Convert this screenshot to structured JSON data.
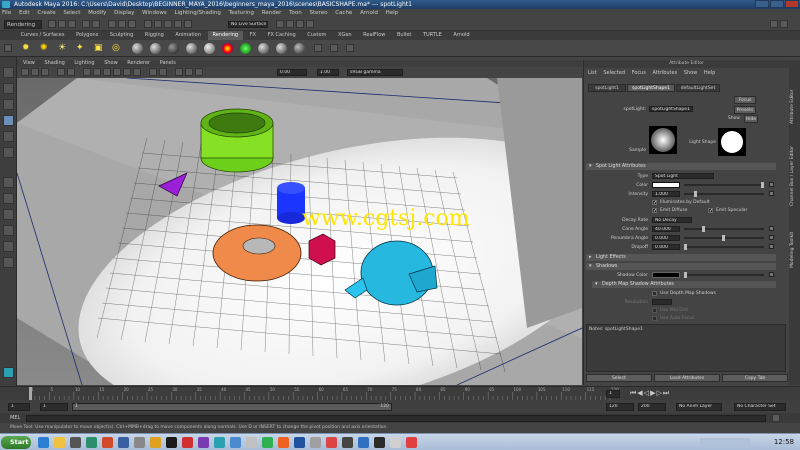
{
  "window": {
    "title": "Autodesk Maya 2016: C:\\Users\\David\\Desktop\\BEGINNER_MAYA_2016\\beginners_maya_2016\\scenes\\BASICSHAPE.ma*   ---   spotLight1"
  },
  "menubar": [
    "File",
    "Edit",
    "Create",
    "Select",
    "Modify",
    "Display",
    "Windows",
    "Lighting/Shading",
    "Texturing",
    "Render",
    "Toon",
    "Stereo",
    "Cache",
    "Arnold",
    "Help"
  ],
  "status": {
    "mode": "Rendering",
    "surface_field": "No Live Surface"
  },
  "shelf_tabs": [
    "Curves / Surfaces",
    "Polygons",
    "Sculpting",
    "Rigging",
    "Animation",
    "Rendering",
    "FX",
    "FX Caching",
    "Custom",
    "XGen",
    "RealFlow",
    "Bullet",
    "TURTLE",
    "Arnold"
  ],
  "shelf_active_tab": "Rendering",
  "viewport": {
    "menu": [
      "View",
      "Shading",
      "Lighting",
      "Show",
      "Renderer",
      "Panels"
    ],
    "field_a": "0.00",
    "field_b": "1.00",
    "color_space": "sRGB gamma",
    "watermark": "www.cgtsj.com"
  },
  "attribute_editor": {
    "title": "Attribute Editor",
    "menu": [
      "List",
      "Selected",
      "Focus",
      "Attributes",
      "Show",
      "Help"
    ],
    "node_tabs": [
      "spotLight1",
      "spotLightShape1",
      "defaultLightSet"
    ],
    "active_tab": "spotLightShape1",
    "node_label": "spotLight:",
    "node_value": "spotLightShape1",
    "focus_btn": "Focus",
    "presets_btn": "Presets",
    "show_label": "Show",
    "hide_btn": "Hide",
    "sample_label": "Sample",
    "light_shape_label": "Light Shape",
    "sections": {
      "spot_light_attributes": "Spot Light Attributes",
      "light_effects": "Light Effects",
      "shadows": "Shadows",
      "depth_map": "Depth Map Shadow Attributes"
    },
    "attrs": {
      "type_label": "Type",
      "type_value": "Spot Light",
      "color_label": "Color",
      "intensity_label": "Intensity",
      "intensity_value": "1.000",
      "illuminates_label": "Illuminates by Default",
      "emit_diffuse_label": "Emit Diffuse",
      "emit_specular_label": "Emit Specular",
      "decay_label": "Decay Rate",
      "decay_value": "No Decay",
      "cone_label": "Cone Angle",
      "cone_value": "40.000",
      "penumbra_label": "Penumbra Angle",
      "penumbra_value": "0.000",
      "dropoff_label": "Dropoff",
      "dropoff_value": "0.000",
      "shadow_color_label": "Shadow Color",
      "use_depth_label": "Use Depth Map Shadows",
      "resolution_label": "Resolution",
      "use_mid_label": "Use Mid Dist",
      "use_auto_focus_label": "Use Auto Focus"
    },
    "notes_label": "Notes: spotLightShape1",
    "buttons": {
      "select": "Select",
      "load": "Load Attributes",
      "copy": "Copy Tab"
    },
    "side_tabs": [
      "Attribute Editor",
      "Channel Box / Layer Editor",
      "Modeling Toolkit"
    ]
  },
  "timeline": {
    "ticks": [
      "1",
      "5",
      "10",
      "15",
      "20",
      "25",
      "30",
      "35",
      "40",
      "45",
      "50",
      "55",
      "60",
      "65",
      "70",
      "75",
      "80",
      "85",
      "90",
      "95",
      "100",
      "105",
      "110",
      "115",
      "120"
    ],
    "current_frame": "1",
    "range_start": "1",
    "range_start2": "1",
    "range_inner_start": "1",
    "range_inner_end": "120",
    "range_end": "120",
    "range_end2": "200",
    "anim_layer": "No Anim Layer",
    "char_set": "No Character Set"
  },
  "cmdline": {
    "label": "MEL"
  },
  "helpline": "Move Tool: Use manipulator to move object(s). Ctrl+MMB+drag to move components along normals. Use D or INSERT to change the pivot position and axis orientation.",
  "taskbar": {
    "start": "Start",
    "clock": "12:58"
  }
}
